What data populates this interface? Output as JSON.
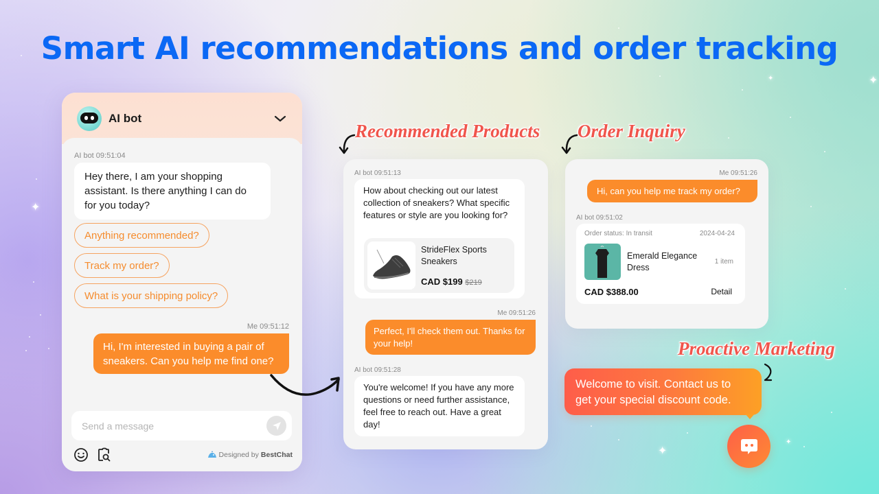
{
  "headline": "Smart AI recommendations and order tracking",
  "labels": {
    "recommended": "Recommended Products",
    "order_inquiry": "Order Inquiry",
    "proactive": "Proactive Marketing"
  },
  "colors": {
    "headline": "#0b68f5",
    "accent_orange": "#fb8c2b",
    "label_red": "#f0554c"
  },
  "widget": {
    "bot_name": "AI bot",
    "avatar_icon": "robot-avatar-icon",
    "collapse_icon": "chevron-down-icon",
    "messages": [
      {
        "sender": "AI bot",
        "time": "09:51:04",
        "meta": "AI bot 09:51:04",
        "text": "Hey there, I am your shopping assistant. Is there anything I can do for you today?"
      },
      {
        "sender": "Me",
        "time": "09:51:12",
        "meta": "Me 09:51:12",
        "text": "Hi, I'm interested in buying a pair of sneakers. Can you help me find one?"
      }
    ],
    "quick_replies": [
      "Anything recommended?",
      "Track my order?",
      "What is your shipping policy?"
    ],
    "input_placeholder": "Send a message",
    "send_icon": "send-icon",
    "emoji_icon": "emoji-icon",
    "image_search_icon": "image-search-icon",
    "powered_prefix": "Designed by",
    "powered_brand": "BestChat"
  },
  "recommend_panel": {
    "messages": [
      {
        "meta": "AI bot 09:51:13",
        "text": "How about checking out our latest collection of sneakers? What specific features or style are you looking for?"
      },
      {
        "meta": "Me 09:51:26",
        "text": "Perfect, I'll check them out. Thanks for your help!"
      },
      {
        "meta": "AI bot 09:51:28",
        "text": "You're welcome! If you have any more questions or need further assistance, feel free to reach out. Have a great day!"
      }
    ],
    "product": {
      "name_line1": "StrideFlex Sports",
      "name_line2": "Sneakers",
      "price": "CAD $199",
      "original_price": "$219"
    }
  },
  "order_panel": {
    "user_meta": "Me 09:51:26",
    "user_text": "Hi, can you help me track my order?",
    "bot_meta": "AI bot 09:51:02",
    "order": {
      "status": "Order status: In transit",
      "date": "2024-04-24",
      "item_line1": "Emerald Elegance",
      "item_line2": "Dress",
      "quantity": "1 item",
      "total": "CAD $388.00",
      "detail_label": "Detail"
    }
  },
  "proactive": {
    "line1": "Welcome to visit. Contact us to",
    "line2": "get your special discount code.",
    "launcher_icon": "chat-launcher-icon"
  }
}
